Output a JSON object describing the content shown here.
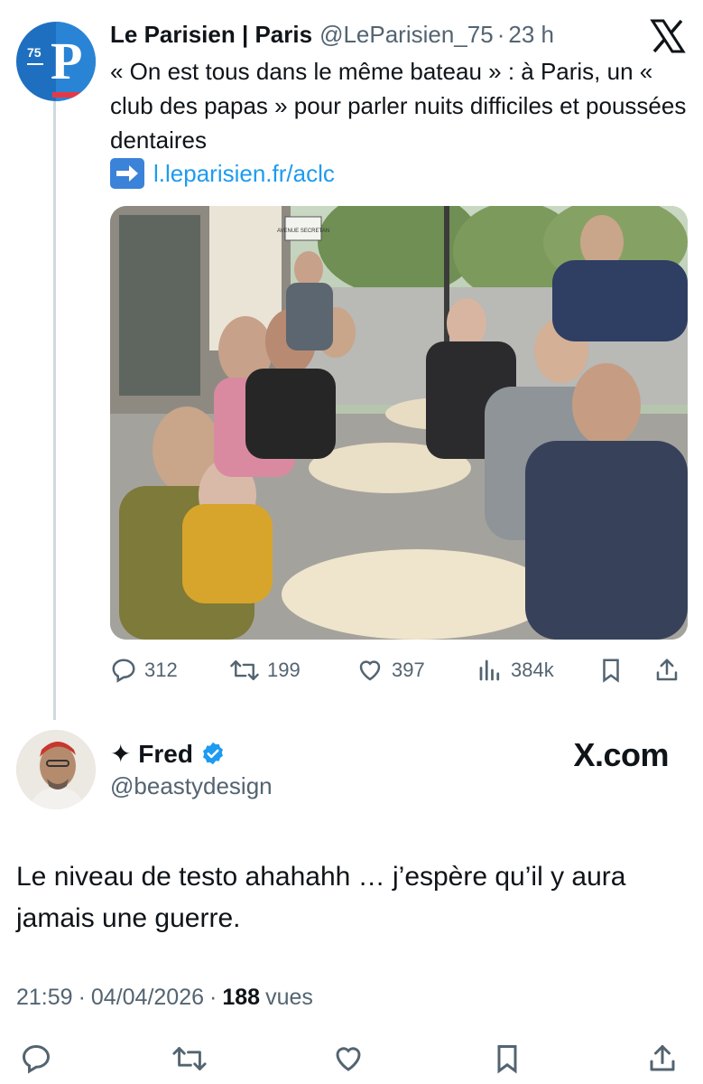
{
  "parent_tweet": {
    "avatar_label": "75",
    "avatar_letter": "P",
    "name": "Le Parisien | Paris",
    "handle": "@LeParisien_75",
    "time": "23 h",
    "text": "« On est tous dans le même bateau » : à Paris, un « club des papas » pour parler nuits difficiles et poussées dentaires",
    "link_text": "l.leparisien.fr/aclc",
    "photo_sign": "AVENUE SECRETAN",
    "stats": {
      "replies": "312",
      "reposts": "199",
      "likes": "397",
      "views": "384k"
    }
  },
  "reply_tweet": {
    "name": "✦ Fred",
    "verified": true,
    "handle": "@beastydesign",
    "watermark": "X.com",
    "text": "Le niveau de testo ahahahh … j’espère qu’il y aura jamais une guerre.",
    "time": "21:59",
    "date": "04/04/2026",
    "views_count": "188",
    "views_label": "vues"
  },
  "colors": {
    "text": "#0f1419",
    "secondary": "#536471",
    "link": "#1d9bf0",
    "verified": "#1d9bf0"
  }
}
